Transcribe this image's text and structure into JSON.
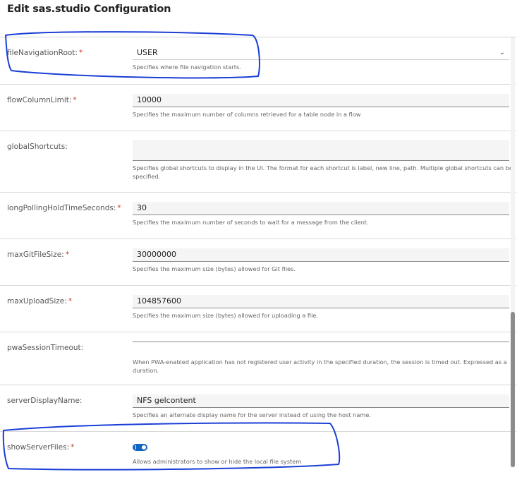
{
  "dialog": {
    "title": "Edit sas.studio Configuration"
  },
  "fields": [
    {
      "key": "fileNavigationRoot",
      "label": "fileNavigationRoot:",
      "required": true,
      "type": "select",
      "value": "USER",
      "help": "Specifies where file navigation starts."
    },
    {
      "key": "flowColumnLimit",
      "label": "flowColumnLimit:",
      "required": true,
      "type": "text",
      "value": "10000",
      "help": "Specifies the maximum number of columns retrieved for a table node in a flow"
    },
    {
      "key": "globalShortcuts",
      "label": "globalShortcuts:",
      "required": false,
      "type": "textarea",
      "value": "",
      "help": "Specifies global shortcuts to display in the UI. The format for each shortcut is label, new line, path. Multiple global shortcuts can be specified."
    },
    {
      "key": "longPollingHoldTimeSeconds",
      "label": "longPollingHoldTimeSeconds:",
      "required": true,
      "type": "text",
      "value": "30",
      "help": "Specifies the maximum number of seconds to wait for a message from the client."
    },
    {
      "key": "maxGitFileSize",
      "label": "maxGitFileSize:",
      "required": true,
      "type": "text",
      "value": "30000000",
      "help": "Specifies the maximum size (bytes) allowed for Git files."
    },
    {
      "key": "maxUploadSize",
      "label": "maxUploadSize:",
      "required": true,
      "type": "text",
      "value": "104857600",
      "help": "Specifies the maximum size (bytes) allowed for uploading a file."
    },
    {
      "key": "pwaSessionTimeout",
      "label": "pwaSessionTimeout:",
      "required": false,
      "type": "text",
      "value": "",
      "help": "When PWA-enabled application has not registered user activity in the specified duration, the session is timed out. Expressed as a duration."
    },
    {
      "key": "serverDisplayName",
      "label": "serverDisplayName:",
      "required": false,
      "type": "text",
      "value": "NFS gelcontent",
      "help": "Specifies an alternate display name for the server instead of using the host name."
    },
    {
      "key": "showServerFiles",
      "label": "showServerFiles:",
      "required": true,
      "type": "toggle",
      "value": "on",
      "help": "Allows administrators to show or hide the local file system"
    }
  ],
  "required_marker": "*",
  "colors": {
    "accent": "#1565c0",
    "annotation": "#1a3fd6",
    "required": "#c0392b"
  },
  "icons": {
    "select_chevron": "chevron-down-icon"
  }
}
